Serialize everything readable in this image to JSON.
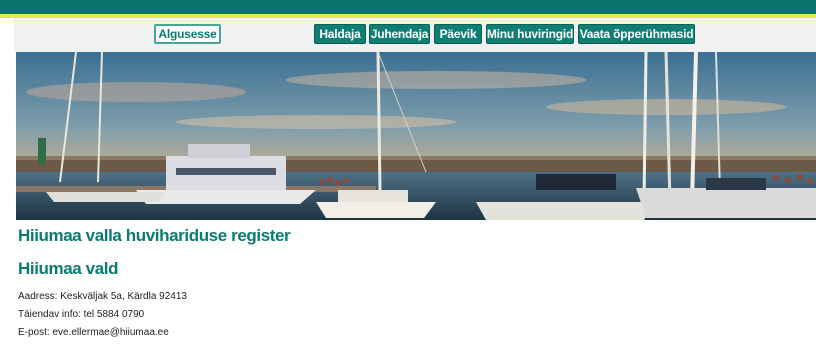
{
  "nav": {
    "items": [
      {
        "label": "Algusesse",
        "active": true
      },
      {
        "label": "Haldaja",
        "active": false
      },
      {
        "label": "Juhendaja",
        "active": false
      },
      {
        "label": "Päevik",
        "active": false
      },
      {
        "label": "Minu huviringid",
        "active": false
      },
      {
        "label": "Vaata õpperühmasid",
        "active": false
      }
    ]
  },
  "banner": {
    "alt_icon": "harbor-photo"
  },
  "main": {
    "title": "Hiiumaa valla huvihariduse register",
    "org_name": "Hiiumaa vald",
    "address": "Aadress: Keskväljak 5a, Kärdla 92413",
    "phone": "Täiendav info: tel 5884 0790",
    "email": "E-post: eve.ellermae@hiiumaa.ee"
  },
  "colors": {
    "brand": "#0a7568",
    "accent_line": "#e6e64d",
    "heading": "#0b7b6f"
  }
}
